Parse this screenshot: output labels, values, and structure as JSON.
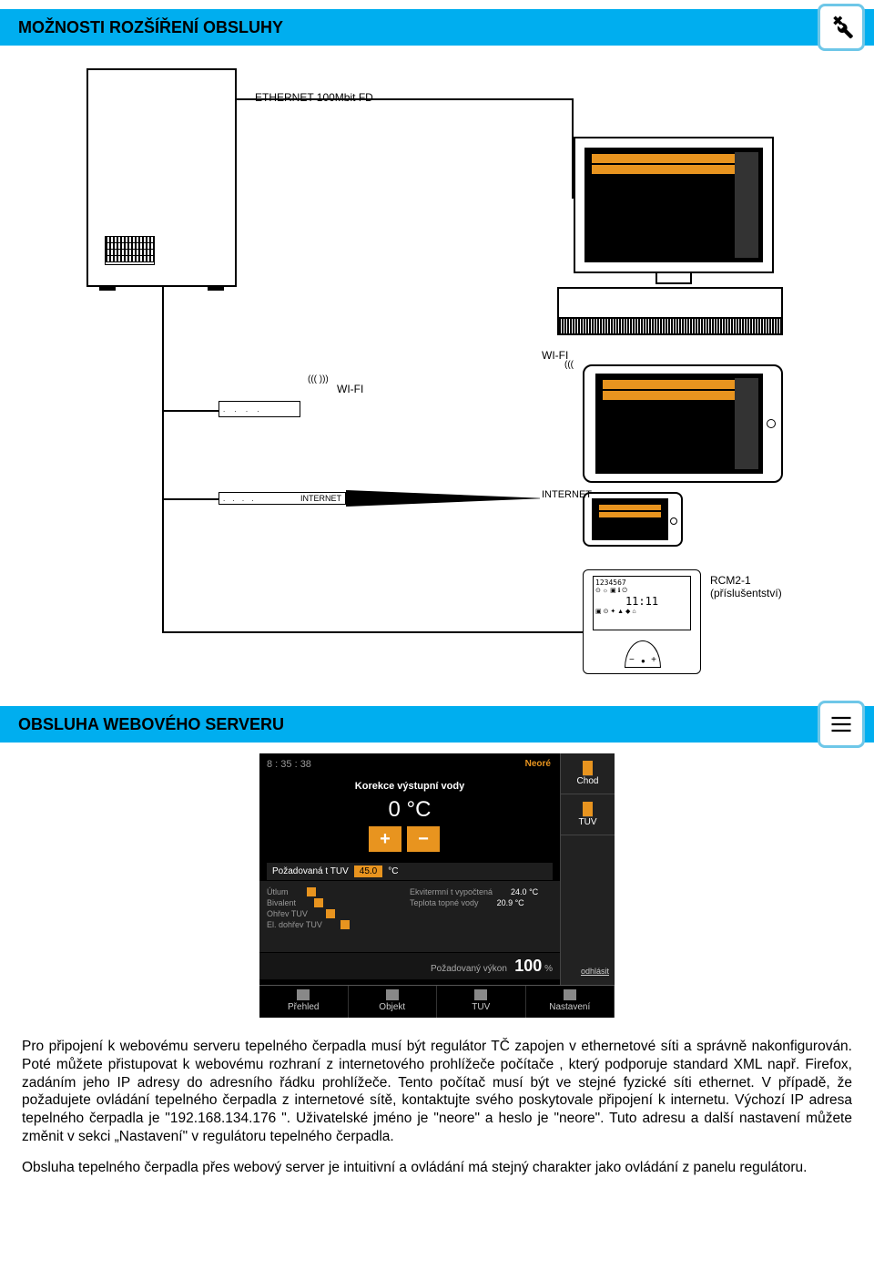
{
  "section1_title": "MOŽNOSTI ROZŠÍŘENÍ OBSLUHY",
  "section2_title": "OBSLUHA WEBOVÉHO SERVERU",
  "diagram": {
    "ethernet": "ETHERNET 100Mbit FD",
    "wifi": "WI-FI",
    "internet": "INTERNET",
    "rcm_model": "RCM2-1",
    "rcm_note": "(příslušentství)",
    "rcm_lcd_digits": "1234567",
    "rcm_lcd_time": "11:11"
  },
  "webui": {
    "time": "8 : 35 : 38",
    "brand": "Neoré",
    "title": "Korekce výstupní vody",
    "big_value": "0 °C",
    "req_label": "Požadovaná t TUV",
    "req_value": "45.0",
    "req_unit": "°C",
    "rows": [
      {
        "l": "Útlum"
      },
      {
        "l": "Bivalent"
      },
      {
        "l": "Ohřev TUV"
      },
      {
        "l": "El. dohřev TUV"
      }
    ],
    "right_rows": [
      {
        "l": "Ekvitermní t vypočtená",
        "v": "24.0 °C"
      },
      {
        "l": "Teplota topné vody",
        "v": "20.9 °C"
      }
    ],
    "power_label": "Požadovaný výkon",
    "power_value": "100",
    "power_unit": "%",
    "side": {
      "chod": "Chod",
      "tuv": "TUV",
      "logout": "odhlásit"
    },
    "bottom": [
      "Přehled",
      "Objekt",
      "TUV",
      "Nastavení"
    ]
  },
  "paragraph1": "Pro připojení k webovému serveru tepelného čerpadla musí být regulátor TČ zapojen v ethernetové síti a správně nakonfigurován. Poté můžete přistupovat k webovému rozhraní z internetového prohlížeče počítače , který podporuje standard XML např. Firefox, zadáním jeho IP adresy do adresního řádku prohlížeče. Tento počítač musí být ve stejné fyzické síti ethernet. V případě, že požadujete ovládání tepelného čerpadla z internetové sítě, kontaktujte svého poskytovale připojení k internetu.  Výchozí IP adresa tepelného čerpadla je \"192.168.134.176 \". Uživatelské jméno je \"neore\" a heslo je \"neore\". Tuto adresu a další nastavení můžete změnit v sekci „Nastavení\" v regulátoru tepelného čerpadla.",
  "paragraph2": "Obsluha tepelného čerpadla přes webový server je intuitivní a ovládání má stejný charakter jako ovládání z panelu regulátoru."
}
